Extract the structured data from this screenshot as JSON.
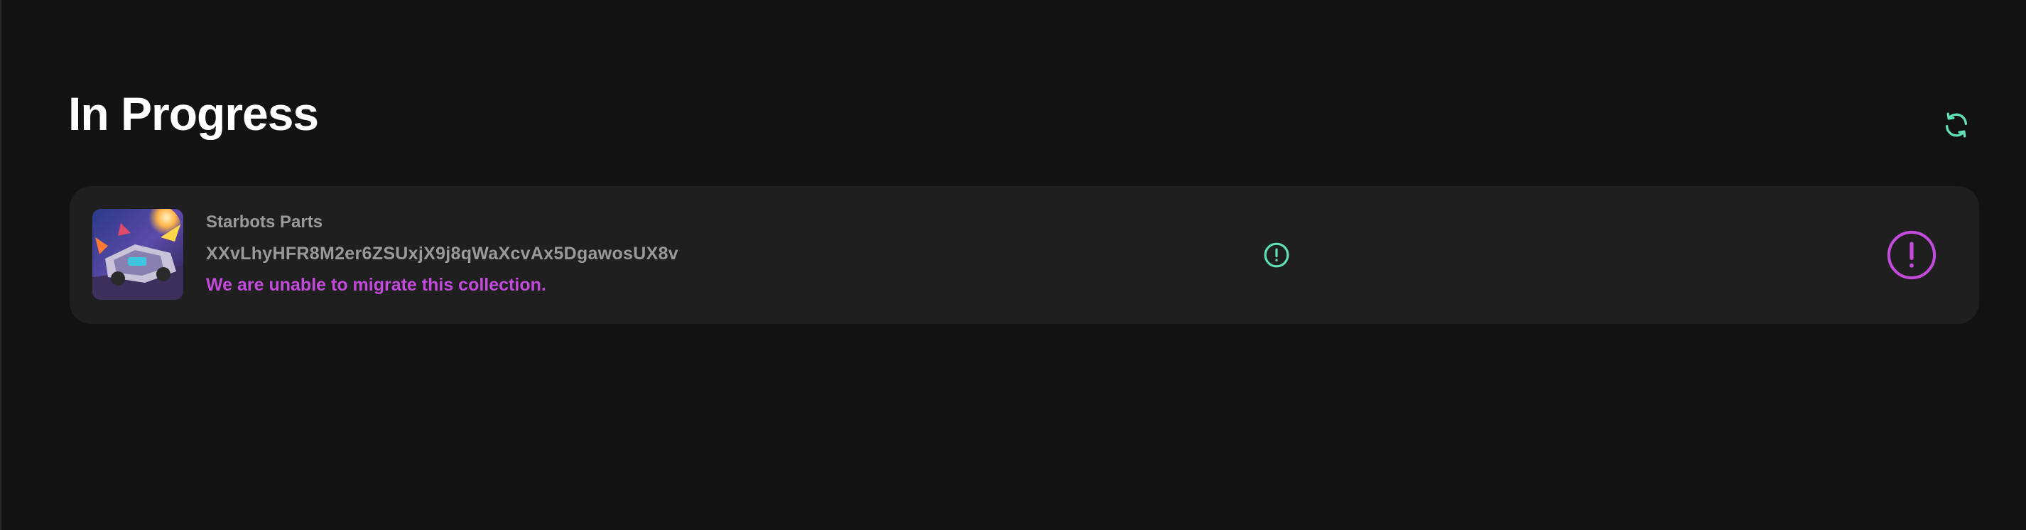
{
  "header": {
    "title": "In Progress",
    "refresh_icon": "refresh-icon"
  },
  "collection": {
    "name": "Starbots Parts",
    "address": "XXvLhyHFR8M2er6ZSUxjX9j8qWaXcvAx5DgawosUX8v",
    "error_message": "We are unable to migrate this collection.",
    "thumbnail": "collection-thumbnail",
    "status_icon": "alert-circle-icon",
    "error_icon": "alert-circle-icon"
  },
  "colors": {
    "background": "#121212",
    "card": "#1f1f1f",
    "accent_green": "#5ee2b6",
    "error_purple": "#c34bdc",
    "muted_text": "#9a9a9a"
  }
}
